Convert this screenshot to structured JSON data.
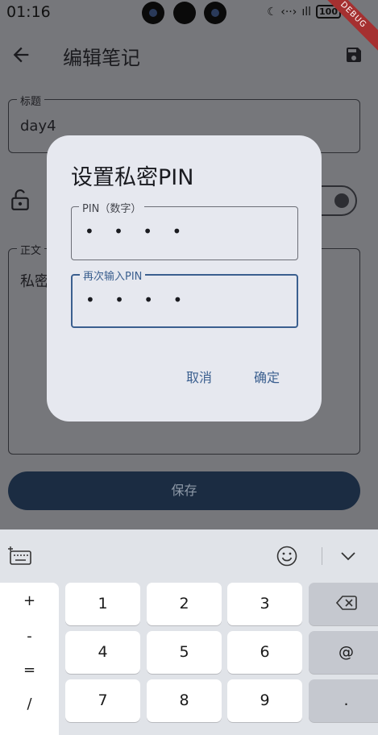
{
  "status_bar": {
    "time": "01:16",
    "right_text": "☾ ‹··›",
    "battery": "100",
    "ribbon": "DEBUG"
  },
  "appbar": {
    "title": "编辑笔记"
  },
  "form": {
    "title_label": "标题",
    "title_value": "day4",
    "body_label": "正文",
    "body_value": "私密",
    "save_button": "保存"
  },
  "dialog": {
    "title": "设置私密PIN",
    "pin_label": "PIN（数字）",
    "pin_value": "• • • •",
    "confirm_label": "再次输入PIN",
    "confirm_value": "• • • •",
    "cancel": "取消",
    "ok": "确定"
  },
  "keyboard": {
    "side_keys": [
      "+",
      "-",
      "=",
      "/"
    ],
    "rows": [
      [
        "1",
        "2",
        "3"
      ],
      [
        "4",
        "5",
        "6"
      ],
      [
        "7",
        "8",
        "9"
      ]
    ],
    "at_key": "@",
    "dot_key": "."
  }
}
